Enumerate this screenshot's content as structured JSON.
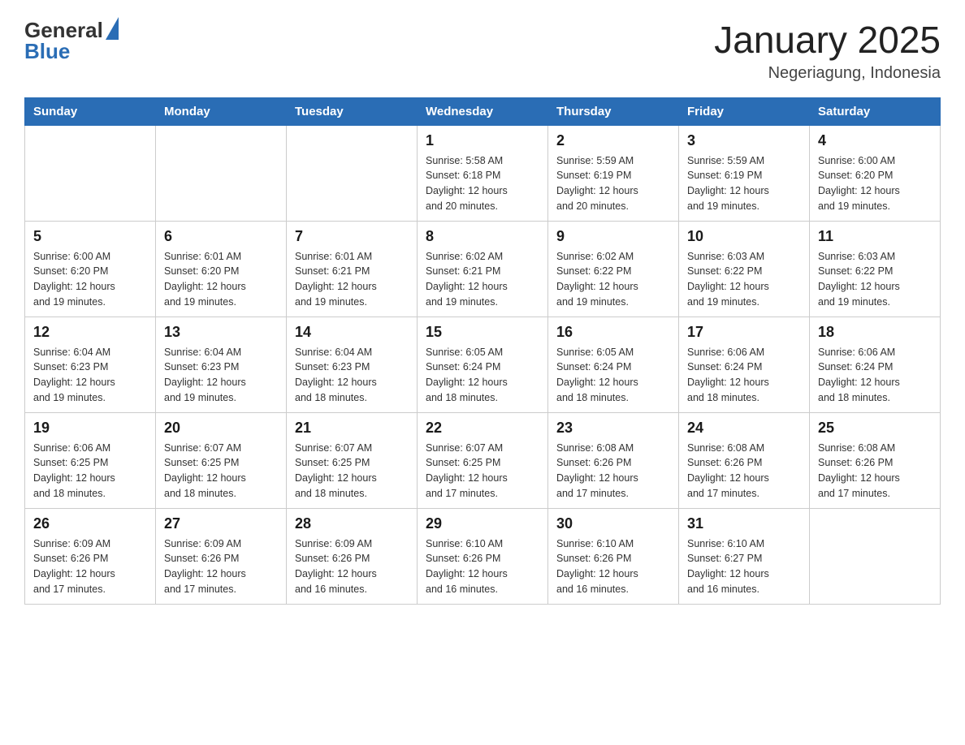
{
  "header": {
    "logo_general": "General",
    "logo_blue": "Blue",
    "title": "January 2025",
    "subtitle": "Negeriagung, Indonesia"
  },
  "days_of_week": [
    "Sunday",
    "Monday",
    "Tuesday",
    "Wednesday",
    "Thursday",
    "Friday",
    "Saturday"
  ],
  "weeks": [
    {
      "days": [
        {
          "num": "",
          "info": ""
        },
        {
          "num": "",
          "info": ""
        },
        {
          "num": "",
          "info": ""
        },
        {
          "num": "1",
          "info": "Sunrise: 5:58 AM\nSunset: 6:18 PM\nDaylight: 12 hours\nand 20 minutes."
        },
        {
          "num": "2",
          "info": "Sunrise: 5:59 AM\nSunset: 6:19 PM\nDaylight: 12 hours\nand 20 minutes."
        },
        {
          "num": "3",
          "info": "Sunrise: 5:59 AM\nSunset: 6:19 PM\nDaylight: 12 hours\nand 19 minutes."
        },
        {
          "num": "4",
          "info": "Sunrise: 6:00 AM\nSunset: 6:20 PM\nDaylight: 12 hours\nand 19 minutes."
        }
      ]
    },
    {
      "days": [
        {
          "num": "5",
          "info": "Sunrise: 6:00 AM\nSunset: 6:20 PM\nDaylight: 12 hours\nand 19 minutes."
        },
        {
          "num": "6",
          "info": "Sunrise: 6:01 AM\nSunset: 6:20 PM\nDaylight: 12 hours\nand 19 minutes."
        },
        {
          "num": "7",
          "info": "Sunrise: 6:01 AM\nSunset: 6:21 PM\nDaylight: 12 hours\nand 19 minutes."
        },
        {
          "num": "8",
          "info": "Sunrise: 6:02 AM\nSunset: 6:21 PM\nDaylight: 12 hours\nand 19 minutes."
        },
        {
          "num": "9",
          "info": "Sunrise: 6:02 AM\nSunset: 6:22 PM\nDaylight: 12 hours\nand 19 minutes."
        },
        {
          "num": "10",
          "info": "Sunrise: 6:03 AM\nSunset: 6:22 PM\nDaylight: 12 hours\nand 19 minutes."
        },
        {
          "num": "11",
          "info": "Sunrise: 6:03 AM\nSunset: 6:22 PM\nDaylight: 12 hours\nand 19 minutes."
        }
      ]
    },
    {
      "days": [
        {
          "num": "12",
          "info": "Sunrise: 6:04 AM\nSunset: 6:23 PM\nDaylight: 12 hours\nand 19 minutes."
        },
        {
          "num": "13",
          "info": "Sunrise: 6:04 AM\nSunset: 6:23 PM\nDaylight: 12 hours\nand 19 minutes."
        },
        {
          "num": "14",
          "info": "Sunrise: 6:04 AM\nSunset: 6:23 PM\nDaylight: 12 hours\nand 18 minutes."
        },
        {
          "num": "15",
          "info": "Sunrise: 6:05 AM\nSunset: 6:24 PM\nDaylight: 12 hours\nand 18 minutes."
        },
        {
          "num": "16",
          "info": "Sunrise: 6:05 AM\nSunset: 6:24 PM\nDaylight: 12 hours\nand 18 minutes."
        },
        {
          "num": "17",
          "info": "Sunrise: 6:06 AM\nSunset: 6:24 PM\nDaylight: 12 hours\nand 18 minutes."
        },
        {
          "num": "18",
          "info": "Sunrise: 6:06 AM\nSunset: 6:24 PM\nDaylight: 12 hours\nand 18 minutes."
        }
      ]
    },
    {
      "days": [
        {
          "num": "19",
          "info": "Sunrise: 6:06 AM\nSunset: 6:25 PM\nDaylight: 12 hours\nand 18 minutes."
        },
        {
          "num": "20",
          "info": "Sunrise: 6:07 AM\nSunset: 6:25 PM\nDaylight: 12 hours\nand 18 minutes."
        },
        {
          "num": "21",
          "info": "Sunrise: 6:07 AM\nSunset: 6:25 PM\nDaylight: 12 hours\nand 18 minutes."
        },
        {
          "num": "22",
          "info": "Sunrise: 6:07 AM\nSunset: 6:25 PM\nDaylight: 12 hours\nand 17 minutes."
        },
        {
          "num": "23",
          "info": "Sunrise: 6:08 AM\nSunset: 6:26 PM\nDaylight: 12 hours\nand 17 minutes."
        },
        {
          "num": "24",
          "info": "Sunrise: 6:08 AM\nSunset: 6:26 PM\nDaylight: 12 hours\nand 17 minutes."
        },
        {
          "num": "25",
          "info": "Sunrise: 6:08 AM\nSunset: 6:26 PM\nDaylight: 12 hours\nand 17 minutes."
        }
      ]
    },
    {
      "days": [
        {
          "num": "26",
          "info": "Sunrise: 6:09 AM\nSunset: 6:26 PM\nDaylight: 12 hours\nand 17 minutes."
        },
        {
          "num": "27",
          "info": "Sunrise: 6:09 AM\nSunset: 6:26 PM\nDaylight: 12 hours\nand 17 minutes."
        },
        {
          "num": "28",
          "info": "Sunrise: 6:09 AM\nSunset: 6:26 PM\nDaylight: 12 hours\nand 16 minutes."
        },
        {
          "num": "29",
          "info": "Sunrise: 6:10 AM\nSunset: 6:26 PM\nDaylight: 12 hours\nand 16 minutes."
        },
        {
          "num": "30",
          "info": "Sunrise: 6:10 AM\nSunset: 6:26 PM\nDaylight: 12 hours\nand 16 minutes."
        },
        {
          "num": "31",
          "info": "Sunrise: 6:10 AM\nSunset: 6:27 PM\nDaylight: 12 hours\nand 16 minutes."
        },
        {
          "num": "",
          "info": ""
        }
      ]
    }
  ]
}
